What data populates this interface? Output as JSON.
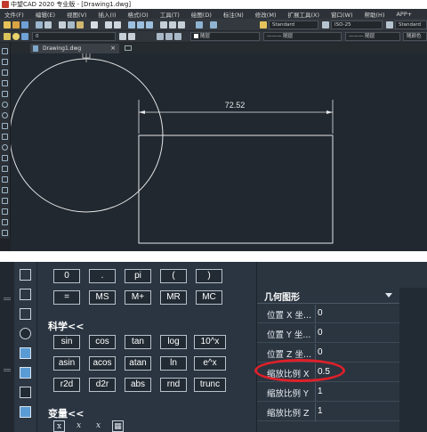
{
  "window": {
    "title": "中望CAD 2020 专业版 - [Drawing1.dwg]"
  },
  "menubar": {
    "items": [
      "文件(F)",
      "编辑(E)",
      "视图(V)",
      "插入(I)",
      "格式(O)",
      "工具(T)",
      "绘图(D)",
      "标注(N)",
      "修改(M)",
      "扩展工具(X)",
      "窗口(W)",
      "帮助(H)",
      "APP+"
    ]
  },
  "toolbar": {
    "text_style": "Standard",
    "dim_scale": "ISO-25",
    "table_style": "Standard",
    "layer_value": "0",
    "color_value": "随层",
    "linetype_value": "——— 随层",
    "lineweight_value": "——— 随层",
    "plot_style": "随颜色"
  },
  "document_tab": {
    "name": "Drawing1.dwg",
    "close": "×"
  },
  "drawing": {
    "dimension_text": "72.52"
  },
  "calculator": {
    "rows": [
      [
        "0",
        ".",
        "pi",
        "(",
        ")"
      ],
      [
        "=",
        "MS",
        "M+",
        "MR",
        "MC"
      ]
    ],
    "science_title": "科学<<",
    "science_rows": [
      [
        "sin",
        "cos",
        "tan",
        "log",
        "10^x"
      ],
      [
        "asin",
        "acos",
        "atan",
        "ln",
        "e^x"
      ],
      [
        "r2d",
        "d2r",
        "abs",
        "rnd",
        "trunc"
      ]
    ],
    "variables_title": "变量<<",
    "variable_icons": [
      "x",
      "x",
      "x",
      "calc"
    ]
  },
  "properties": {
    "group_title": "几何图形",
    "rows": [
      {
        "label": "位置 X 坐...",
        "value": "0"
      },
      {
        "label": "位置 Y 坐...",
        "value": "0"
      },
      {
        "label": "位置 Z 坐...",
        "value": "0"
      },
      {
        "label": "缩放比例 X",
        "value": "0.5"
      },
      {
        "label": "缩放比例 Y",
        "value": "1"
      },
      {
        "label": "缩放比例 Z",
        "value": "1"
      }
    ]
  },
  "colors": {
    "highlight": "#e0202a",
    "canvas": "#212830",
    "panel": "#2a3541",
    "button_border": "#b8c2cc"
  }
}
